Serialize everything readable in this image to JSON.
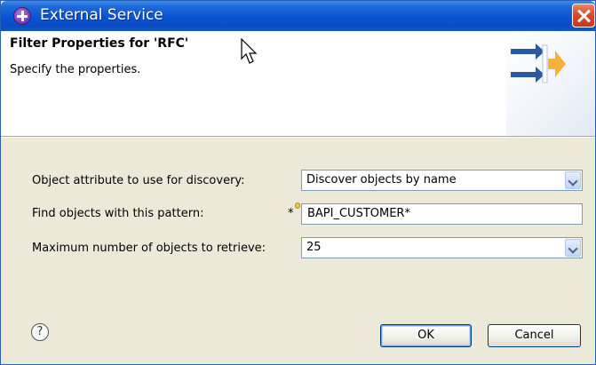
{
  "window": {
    "title": "External Service"
  },
  "banner": {
    "title": "Filter Properties for 'RFC'",
    "description": "Specify the properties."
  },
  "form": {
    "object_attribute": {
      "label": "Object attribute to use for discovery:",
      "value": "Discover objects by name"
    },
    "find_pattern": {
      "label": "Find objects with this pattern:",
      "required_marker": "*",
      "value": "BAPI_CUSTOMER*"
    },
    "max_objects": {
      "label": "Maximum number of objects to retrieve:",
      "value": "25"
    }
  },
  "footer": {
    "help_glyph": "?",
    "ok_label": "OK",
    "cancel_label": "Cancel"
  },
  "icons": {
    "app": "external-service-icon",
    "wizard": "import-arrows-icon",
    "close": "close-icon",
    "help": "help-icon"
  },
  "colors": {
    "titlebar": "#0a53d6",
    "close": "#d8472a",
    "dialog_bg": "#ece9d8",
    "wizard_arrow_blue": "#2c5aa0",
    "wizard_arrow_orange": "#f4b23a"
  }
}
